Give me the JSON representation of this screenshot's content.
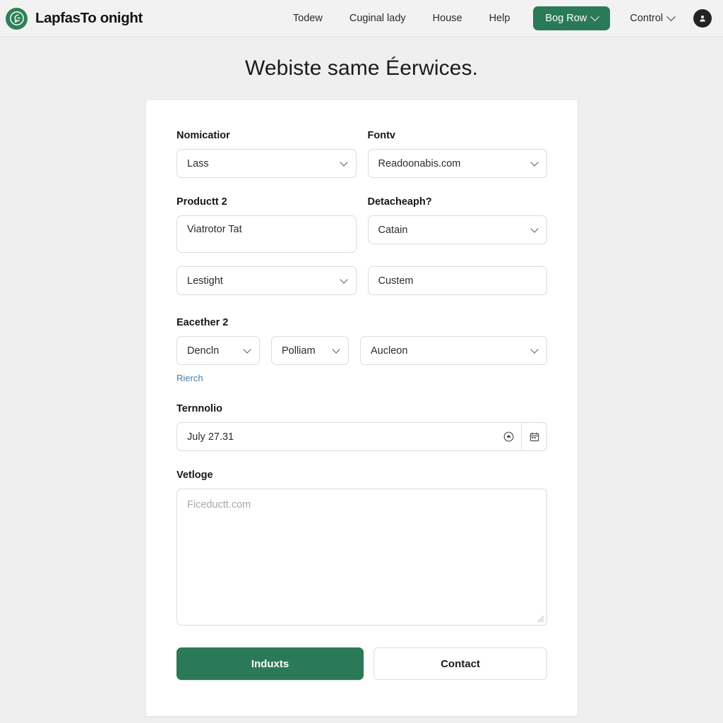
{
  "header": {
    "brand_name": "LapfasTo onight",
    "logo_icon": "circle-leaf-icon",
    "nav_links": [
      {
        "label": "Todew"
      },
      {
        "label": "Cuginal lady"
      },
      {
        "label": "House"
      },
      {
        "label": "Help"
      }
    ],
    "cta": {
      "label": "Bog Row",
      "icon": "chevron-down-icon",
      "color": "#2a7a57"
    },
    "menu": {
      "label": "Control",
      "icon": "chevron-down-icon"
    },
    "avatar": {
      "icon": "user-avatar-icon",
      "color": "#242424"
    }
  },
  "page": {
    "title": "Webiste same Éerwices."
  },
  "form": {
    "row1": {
      "left": {
        "label": "Nomicatior",
        "value": "Lass"
      },
      "right": {
        "label": "Fontv",
        "value": "Readoonabis.com"
      }
    },
    "row2": {
      "left": {
        "label": "Productt 2",
        "value": "Viatrotor Tat"
      },
      "right": {
        "label": "Detacheaph?",
        "value": "Catain"
      }
    },
    "row3": {
      "left": {
        "value": "Lestight"
      },
      "right": {
        "value": "Custem"
      }
    },
    "row4": {
      "label": "Eacether 2",
      "select1": "Dencln",
      "select2": "Polliam",
      "select3": "Aucleon",
      "link": "Rierch"
    },
    "row5": {
      "label": "Ternnolio",
      "value": "July 27.31",
      "icon1": "clock-circle-icon",
      "icon2": "calendar-icon"
    },
    "row6": {
      "label": "Vetloge",
      "placeholder": "Ficeductt.com"
    },
    "actions": {
      "primary": "Induxts",
      "secondary": "Contact"
    }
  },
  "colors": {
    "brand_green": "#2a7a57",
    "page_bg": "#efefef",
    "card_bg": "#ffffff",
    "link_blue": "#4a7fa8",
    "border": "#dcdcdc"
  }
}
